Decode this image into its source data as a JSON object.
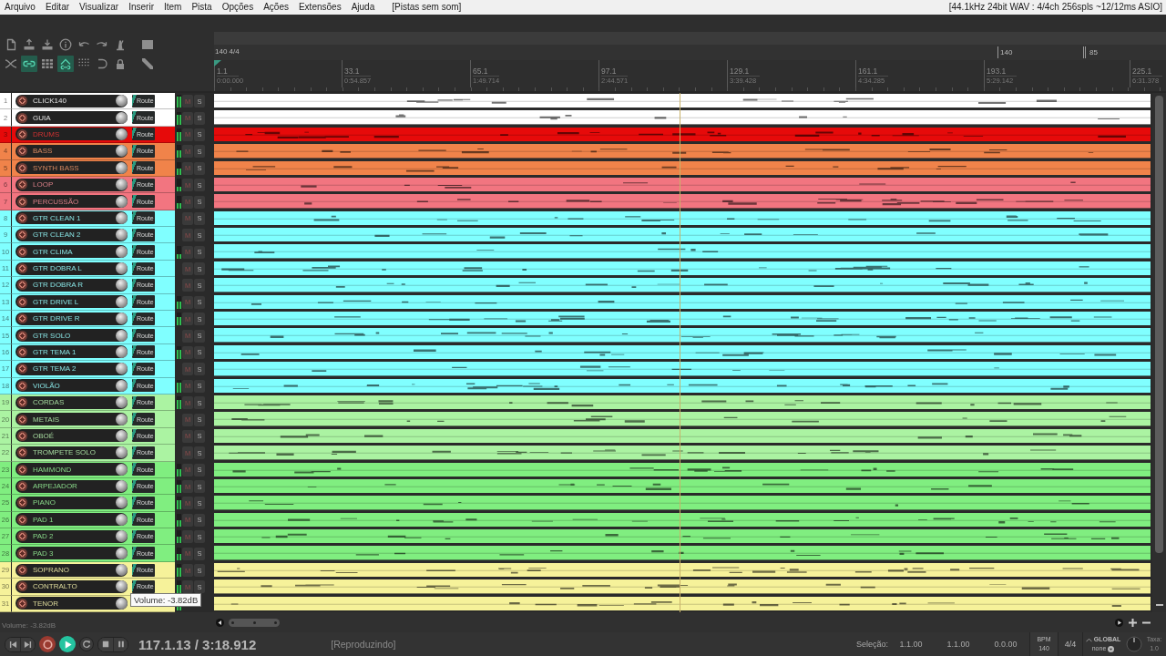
{
  "menu_bar": {
    "items": [
      "Arquivo",
      "Editar",
      "Visualizar",
      "Inserir",
      "Item",
      "Pista",
      "Opções",
      "Ações",
      "Extensões",
      "Ajuda"
    ],
    "status": "[Pistas sem som]",
    "info": "[44.1kHz 24bit WAV : 4/4ch 256spls ~12/12ms ASIO]"
  },
  "toolbar": {
    "rows": [
      [
        {
          "active": false
        },
        {
          "active": false
        },
        {
          "active": false
        },
        {
          "active": false
        },
        {
          "active": false
        },
        {
          "active": false
        },
        {
          "active": false
        },
        {
          "active": false
        }
      ],
      [
        {
          "active": false
        },
        {
          "active": true
        },
        {
          "active": false
        },
        {
          "active": true
        },
        {
          "active": false
        },
        {
          "active": false
        },
        {
          "active": false
        },
        {
          "active": false
        }
      ]
    ]
  },
  "timeline": {
    "tempo_label": "140 4/4",
    "markers": [
      "140",
      "85"
    ],
    "ticks": [
      {
        "bar": "1.1",
        "time": "0:00.000"
      },
      {
        "bar": "33.1",
        "time": "0:54.857"
      },
      {
        "bar": "65.1",
        "time": "1:49.714"
      },
      {
        "bar": "97.1",
        "time": "2:44.571"
      },
      {
        "bar": "129.1",
        "time": "3:39.428"
      },
      {
        "bar": "161.1",
        "time": "4:34.285"
      },
      {
        "bar": "193.1",
        "time": "5:29.142"
      },
      {
        "bar": "225.1",
        "time": "6:31.378"
      }
    ]
  },
  "tracks": [
    {
      "number": "1",
      "name": "CLICK140",
      "color": "#ffffff",
      "route": "Route",
      "mute": "M",
      "solo": "S",
      "meter": {
        "level": 0.85
      }
    },
    {
      "number": "2",
      "name": "GUIA",
      "color": "#ffffff",
      "route": "Route",
      "mute": "M",
      "solo": "S",
      "meter": {
        "level": 0.75
      }
    },
    {
      "number": "3",
      "name": "DRUMS",
      "color": "#e60a0a",
      "route": "Route",
      "mute": "M",
      "solo": "S",
      "meter": {
        "level": 0.7
      }
    },
    {
      "number": "4",
      "name": "BASS",
      "color": "#f0834a",
      "route": "Route",
      "mute": "M",
      "solo": "S",
      "meter": {
        "level": 0.6
      }
    },
    {
      "number": "5",
      "name": "SYNTH BASS",
      "color": "#f0834a",
      "route": "Route",
      "mute": "M",
      "solo": "S",
      "meter": {
        "level": 0.45
      }
    },
    {
      "number": "6",
      "name": "LOOP",
      "color": "#f27580",
      "route": "Route",
      "mute": "M",
      "solo": "S",
      "meter": {
        "level": 0.4
      }
    },
    {
      "number": "7",
      "name": "PERCUSSÃO",
      "color": "#f27580",
      "route": "Route",
      "mute": "M",
      "solo": "S",
      "meter": {
        "level": 0.4
      }
    },
    {
      "number": "8",
      "name": "GTR CLEAN 1",
      "color": "#80ffff",
      "route": "Route",
      "mute": "M",
      "solo": "S"
    },
    {
      "number": "9",
      "name": "GTR CLEAN 2",
      "color": "#80ffff",
      "route": "Route",
      "mute": "M",
      "solo": "S"
    },
    {
      "number": "10",
      "name": "GTR CLIMA",
      "color": "#80ffff",
      "route": "Route",
      "mute": "M",
      "solo": "S",
      "meter": {
        "level": 0.35
      }
    },
    {
      "number": "11",
      "name": "GTR DOBRA L",
      "color": "#80ffff",
      "route": "Route",
      "mute": "M",
      "solo": "S"
    },
    {
      "number": "12",
      "name": "GTR DOBRA R",
      "color": "#80ffff",
      "route": "Route",
      "mute": "M",
      "solo": "S"
    },
    {
      "number": "13",
      "name": "GTR DRIVE L",
      "color": "#80ffff",
      "route": "Route",
      "mute": "M",
      "solo": "S",
      "meter": {
        "level": 0.55
      }
    },
    {
      "number": "14",
      "name": "GTR DRIVE R",
      "color": "#80ffff",
      "route": "Route",
      "mute": "M",
      "solo": "S",
      "meter": {
        "level": 0.65
      }
    },
    {
      "number": "15",
      "name": "GTR SOLO",
      "color": "#80ffff",
      "route": "Route",
      "mute": "M",
      "solo": "S"
    },
    {
      "number": "16",
      "name": "GTR TEMA 1",
      "color": "#80ffff",
      "route": "Route",
      "mute": "M",
      "solo": "S",
      "meter": {
        "level": 0.7
      }
    },
    {
      "number": "17",
      "name": "GTR TEMA 2",
      "color": "#80ffff",
      "route": "Route",
      "mute": "M",
      "solo": "S"
    },
    {
      "number": "18",
      "name": "VIOLÃO",
      "color": "#80ffff",
      "route": "Route",
      "mute": "M",
      "solo": "S",
      "meter": {
        "level": 0.75
      }
    },
    {
      "number": "19",
      "name": "CORDAS",
      "color": "#abf3a2",
      "route": "Route",
      "mute": "M",
      "solo": "S",
      "meter": {
        "level": 0.75
      }
    },
    {
      "number": "20",
      "name": "METAIS",
      "color": "#abf3a2",
      "route": "Route",
      "mute": "M",
      "solo": "S"
    },
    {
      "number": "21",
      "name": "OBOÉ",
      "color": "#abf3a2",
      "route": "Route",
      "mute": "M",
      "solo": "S"
    },
    {
      "number": "22",
      "name": "TROMPETE SOLO",
      "color": "#abf3a2",
      "route": "Route",
      "mute": "M",
      "solo": "S"
    },
    {
      "number": "23",
      "name": "HAMMOND",
      "color": "#80ee80",
      "route": "Route",
      "mute": "M",
      "solo": "S",
      "meter": {
        "level": 0.55
      }
    },
    {
      "number": "24",
      "name": "ARPEJADOR",
      "color": "#80ee80",
      "route": "Route",
      "mute": "M",
      "solo": "S",
      "meter": {
        "level": 0.65
      }
    },
    {
      "number": "25",
      "name": "PIANO",
      "color": "#80ee80",
      "route": "Route",
      "mute": "M",
      "solo": "S",
      "meter": {
        "level": 0.75
      }
    },
    {
      "number": "26",
      "name": "PAD 1",
      "color": "#80ee80",
      "route": "Route",
      "mute": "M",
      "solo": "S",
      "meter": {
        "level": 0.5
      }
    },
    {
      "number": "27",
      "name": "PAD 2",
      "color": "#80ee80",
      "route": "Route",
      "mute": "M",
      "solo": "S",
      "meter": {
        "level": 0.5
      }
    },
    {
      "number": "28",
      "name": "PAD 3",
      "color": "#80ee80",
      "route": "Route",
      "mute": "M",
      "solo": "S",
      "meter": {
        "level": 0.5
      }
    },
    {
      "number": "29",
      "name": "SOPRANO",
      "color": "#f6f29a",
      "route": "Route",
      "mute": "M",
      "solo": "S",
      "meter": {
        "level": 0.75
      }
    },
    {
      "number": "30",
      "name": "CONTRALTO",
      "color": "#f6f29a",
      "route": "Route",
      "mute": "M",
      "solo": "S",
      "meter": {
        "level": 0.65
      }
    },
    {
      "number": "31",
      "name": "TENOR",
      "color": "#f6f29a",
      "meter": {
        "level": 0.9
      }
    }
  ],
  "tooltip": "Volume: -3.82dB",
  "status_text": "Volume: -3.82dB",
  "transport": {
    "playing": true,
    "position": "117.1.13 / 3:18.912",
    "state": "[Reproduzindo]"
  },
  "selection": {
    "label": "Seleção:",
    "values": [
      "1.1.00",
      "1.1.00",
      "0.0.00"
    ]
  },
  "tempo": {
    "label": "BPM",
    "value": "140"
  },
  "time_signature": "4/4",
  "automation": {
    "label": "GLOBAL",
    "mode": "none"
  },
  "rate": {
    "label": "Taxa:",
    "value": "1.0"
  }
}
